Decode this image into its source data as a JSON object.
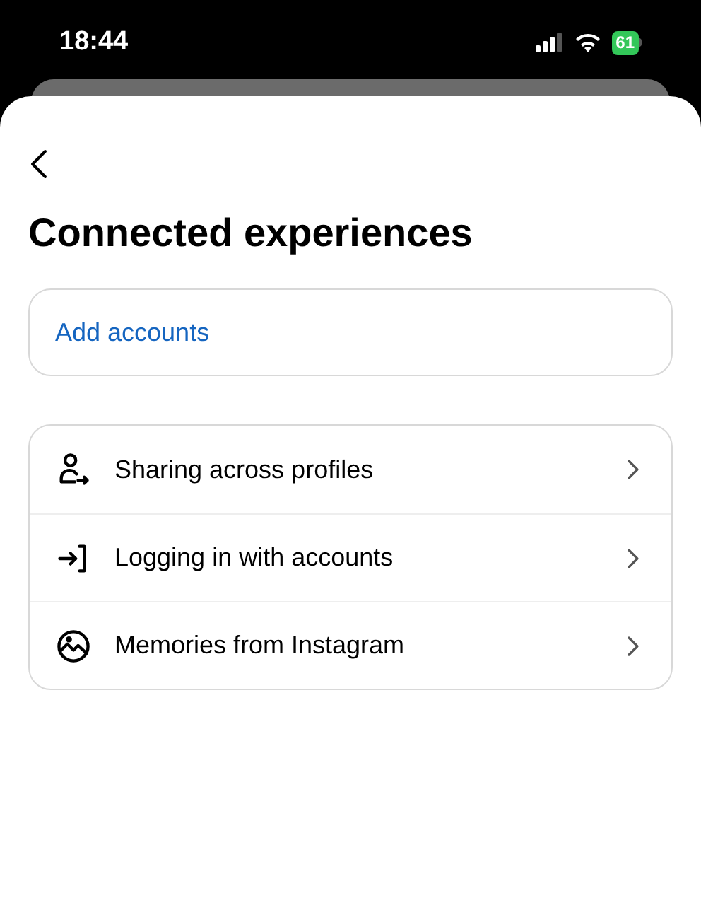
{
  "status_bar": {
    "time": "18:44",
    "battery": "61"
  },
  "title": "Connected experiences",
  "add_accounts": "Add accounts",
  "items": [
    {
      "kind": "profiles",
      "label": "Sharing across profiles"
    },
    {
      "kind": "login",
      "label": "Logging in with accounts"
    },
    {
      "kind": "memories",
      "label": "Memories from Instagram"
    }
  ]
}
